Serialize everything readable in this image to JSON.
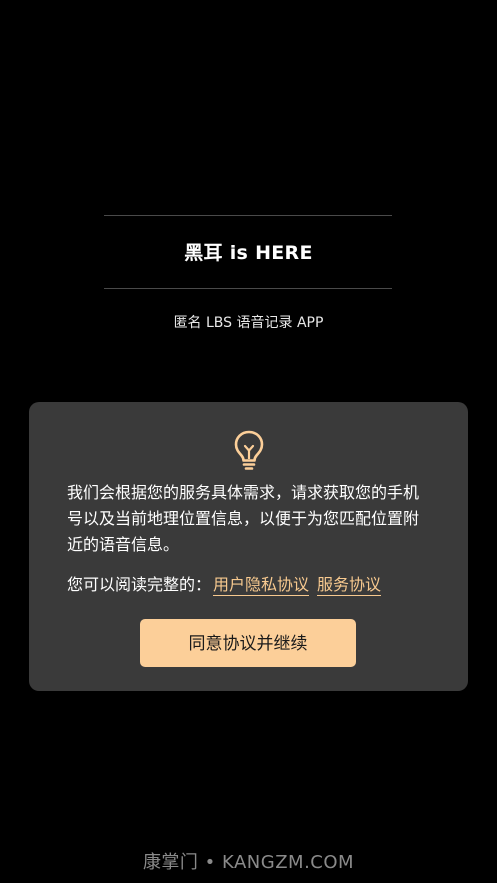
{
  "header": {
    "title": "黑耳 is HERE",
    "subtitle": "匿名 LBS 语音记录 APP"
  },
  "dialog": {
    "icon": "lightbulb-icon",
    "message": "我们会根据您的服务具体需求，请求获取您的手机号以及当前地理位置信息，以便于为您匹配位置附近的语音信息。",
    "links_prefix": "您可以阅读完整的：",
    "privacy_link": "用户隐私协议",
    "service_link": "服务协议",
    "agree_button": "同意协议并继续"
  },
  "watermark": "康掌门 • KANGZM.COM",
  "colors": {
    "background": "#000000",
    "dialog_bg": "#3a3a3a",
    "accent": "#fccf99",
    "link": "#f7c98f"
  }
}
